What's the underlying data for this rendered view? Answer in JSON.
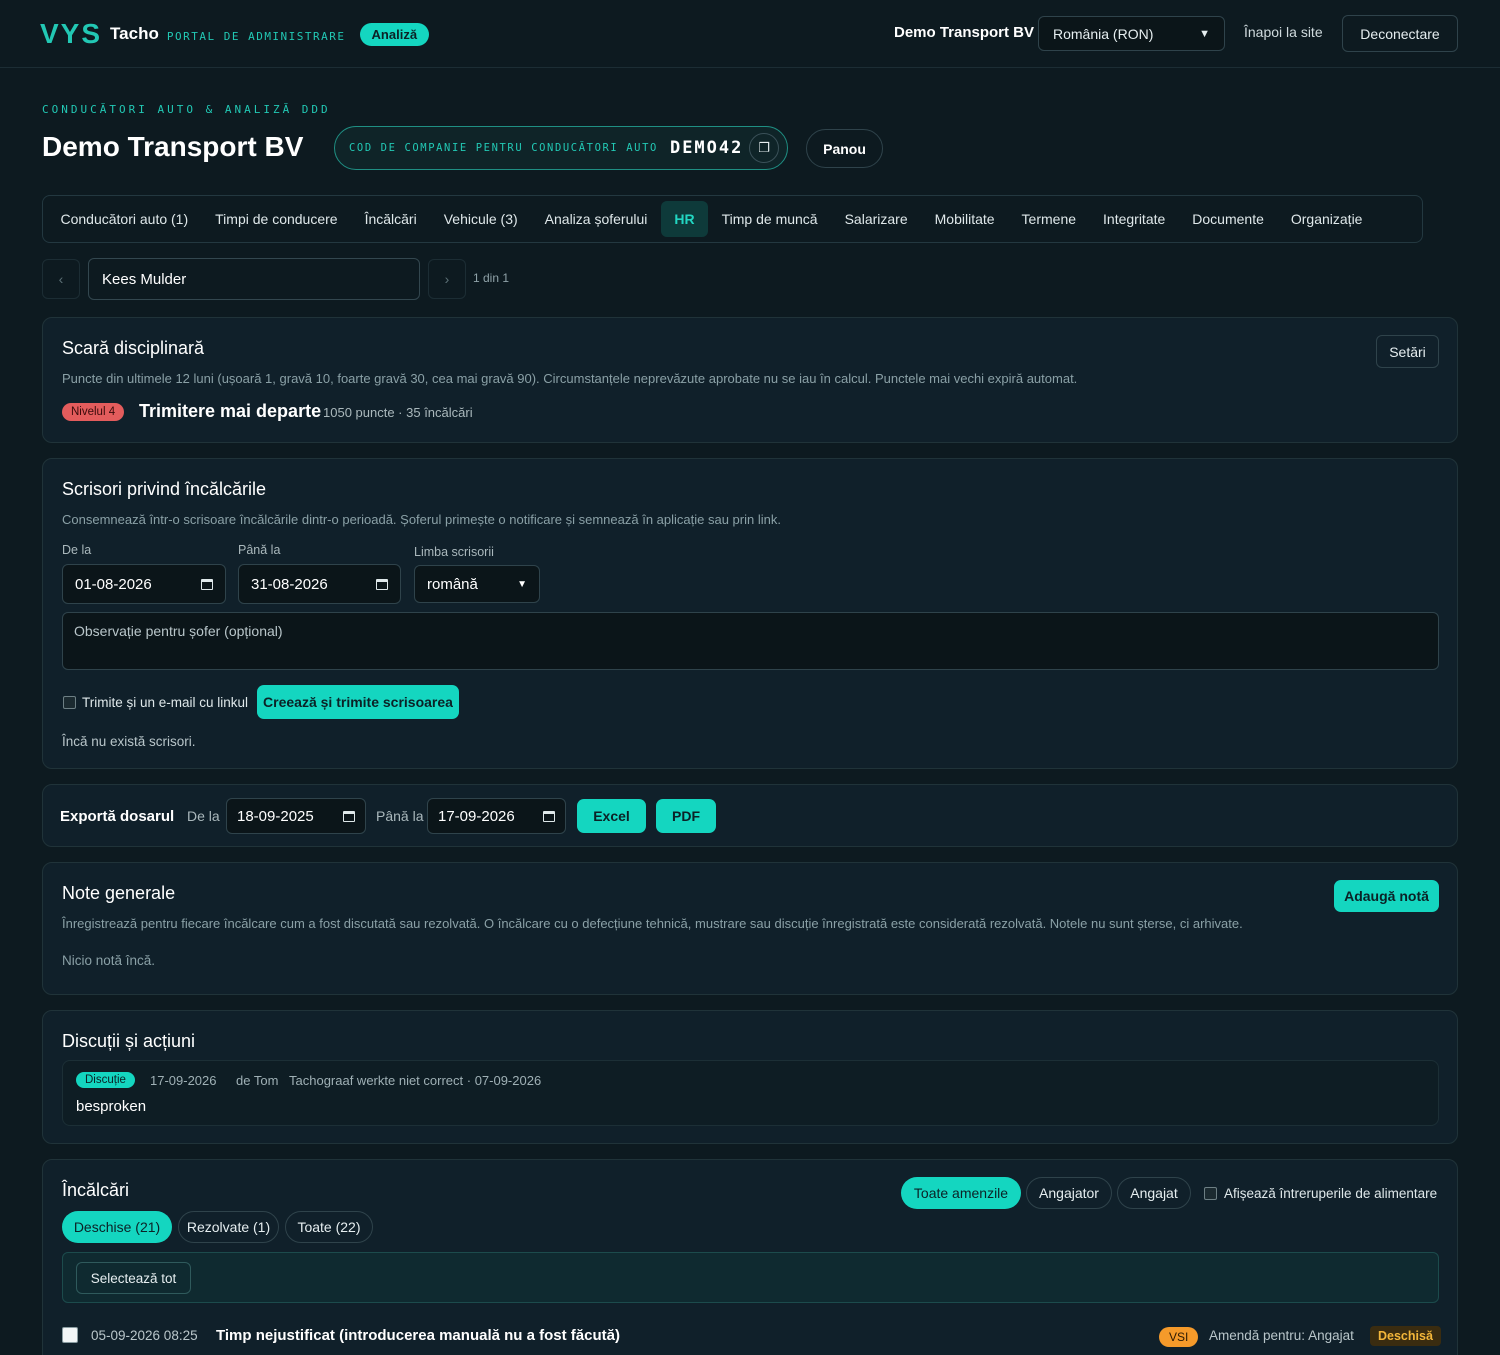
{
  "header": {
    "logo_mark": "VYS",
    "logo_app": "Tacho",
    "logo_portal": "PORTAL DE ADMINISTRARE",
    "mode_badge": "Analiză",
    "company": "Demo Transport BV",
    "country_select": "România (RON)",
    "back_link": "Înapoi la site",
    "logout": "Deconectare"
  },
  "page": {
    "eyebrow": "CONDUCĂTORI AUTO & ANALIZĂ DDD",
    "title": "Demo Transport BV",
    "code_label": "COD DE COMPANIE PENTRU CONDUCĂTORI AUTO",
    "code_value": "DEMO42",
    "panel_button": "Panou"
  },
  "tabs": [
    {
      "label": "Conducători auto (1)",
      "active": false
    },
    {
      "label": "Timpi de conducere",
      "active": false
    },
    {
      "label": "Încălcări",
      "active": false
    },
    {
      "label": "Vehicule (3)",
      "active": false
    },
    {
      "label": "Analiza șoferului",
      "active": false
    },
    {
      "label": "HR",
      "active": true
    },
    {
      "label": "Timp de muncă",
      "active": false
    },
    {
      "label": "Salarizare",
      "active": false
    },
    {
      "label": "Mobilitate",
      "active": false
    },
    {
      "label": "Termene",
      "active": false
    },
    {
      "label": "Integritate",
      "active": false
    },
    {
      "label": "Documente",
      "active": false
    },
    {
      "label": "Organizație",
      "active": false
    }
  ],
  "driver_nav": {
    "prev": "‹",
    "next": "›",
    "selected": "Kees Mulder",
    "count": "1 din 1"
  },
  "discipline": {
    "title": "Scară disciplinară",
    "settings": "Setări",
    "description": "Puncte din ultimele 12 luni (ușoară 1, gravă 10, foarte gravă 30, cea mai gravă 90). Circumstanțele neprevăzute aprobate nu se iau în calcul. Punctele mai vechi expiră automat.",
    "level_badge": "Nivelul 4",
    "level_name": "Trimitere mai departe",
    "level_meta": "1050 puncte · 35 încălcări"
  },
  "letters": {
    "title": "Scrisori privind încălcările",
    "description": "Consemnează într-o scrisoare încălcările dintr-o perioadă. Șoferul primește o notificare și semnează în aplicație sau prin link.",
    "from_label": "De la",
    "from_value": "01-08-2026",
    "to_label": "Până la",
    "to_value": "31-08-2026",
    "lang_label": "Limba scrisorii",
    "lang_value": "română",
    "note_placeholder": "Observație pentru șofer (opțional)",
    "email_check": "Trimite și un e-mail cu linkul",
    "create_button": "Creează și trimite scrisoarea",
    "empty": "Încă nu există scrisori."
  },
  "export": {
    "title": "Exportă dosarul",
    "from_label": "De la",
    "from_value": "18-09-2025",
    "to_label": "Până la",
    "to_value": "17-09-2026",
    "excel": "Excel",
    "pdf": "PDF"
  },
  "notes": {
    "title": "Note generale",
    "add_button": "Adaugă notă",
    "description": "Înregistrează pentru fiecare încălcare cum a fost discutată sau rezolvată. O încălcare cu o defecțiune tehnică, mustrare sau discuție înregistrată este considerată rezolvată. Notele nu sunt șterse, ci arhivate.",
    "empty": "Nicio notă încă."
  },
  "discussions": {
    "title": "Discuții și acțiuni",
    "items": [
      {
        "badge": "Discuție",
        "date": "17-09-2026",
        "author": "de Tom",
        "ref": "Tachograaf werkte niet correct · 07-09-2026",
        "text": "besproken"
      }
    ]
  },
  "violations": {
    "title": "Încălcări",
    "filter_all": "Toate amenzile",
    "filter_employer": "Angajator",
    "filter_employee": "Angajat",
    "power_check": "Afișează întreruperile de alimentare",
    "tab_open": "Deschise (21)",
    "tab_resolved": "Rezolvate (1)",
    "tab_all": "Toate (22)",
    "select_all": "Selectează tot",
    "rows": [
      {
        "datetime": "05-09-2026 08:25",
        "title": "Timp nejustificat (introducerea manuală nu a fost făcută)",
        "severity": "VSI",
        "fine": "Amendă pentru: Angajat",
        "status": "Deschisă"
      }
    ]
  },
  "colors": {
    "background": "#0d1a20",
    "accent": "#14d6c0",
    "danger": "#e35c5c",
    "warning": "#f59a2a"
  }
}
